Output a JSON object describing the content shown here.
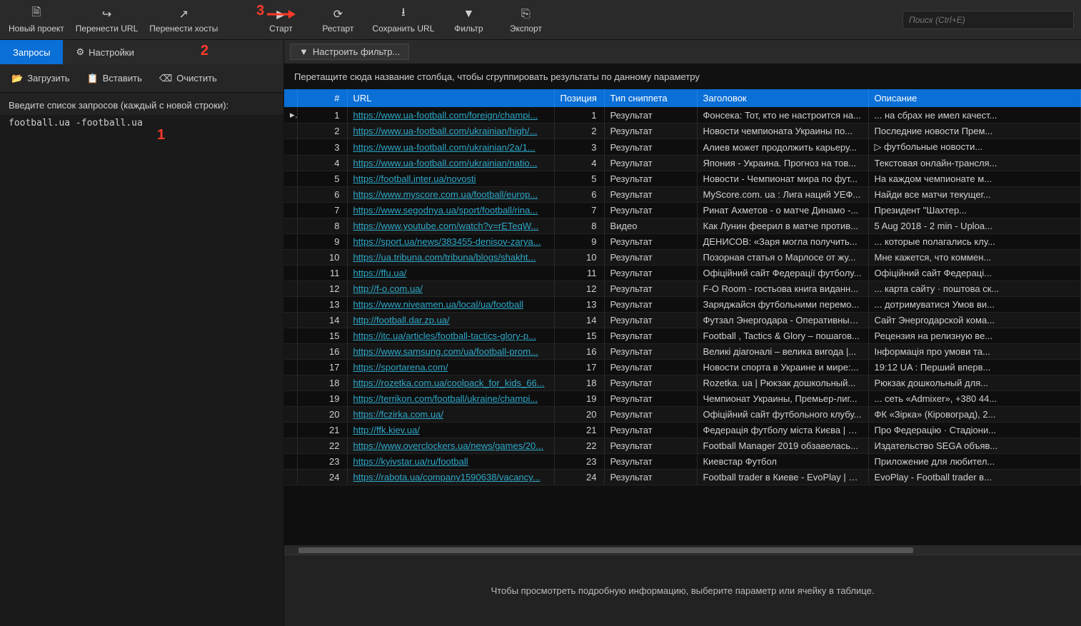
{
  "toolbar": {
    "new_project": "Новый проект",
    "transfer_url": "Перенести URL",
    "transfer_hosts": "Перенести хосты",
    "start": "Старт",
    "restart": "Рестарт",
    "save_url": "Сохранить URL",
    "filter": "Фильтр",
    "export": "Экспорт"
  },
  "search": {
    "placeholder": "Поиск (Ctrl+E)"
  },
  "left": {
    "tab_queries": "Запросы",
    "tab_settings": "Настройки",
    "load": "Загрузить",
    "paste": "Вставить",
    "clear": "Очистить",
    "prompt": "Введите список запросов (каждый с новой строки):",
    "query_text": "football.ua -football.ua"
  },
  "filterbar": {
    "configure": "Настроить фильтр..."
  },
  "group_hint": "Перетащите сюда название столбца, чтобы сгруппировать результаты по данному параметру",
  "columns": {
    "num": "#",
    "url": "URL",
    "position": "Позиция",
    "snippet_type": "Тип сниппета",
    "title": "Заголовок",
    "description": "Описание"
  },
  "rows": [
    {
      "n": 1,
      "url": "https://www.ua-football.com/foreign/champi...",
      "pos": 1,
      "snip": "Результат",
      "title": "Фонсека: Тот, кто не настроится на...",
      "desc": "... на сбрах не имел качест..."
    },
    {
      "n": 2,
      "url": "https://www.ua-football.com/ukrainian/high/...",
      "pos": 2,
      "snip": "Результат",
      "title": "Новости чемпионата Украины по...",
      "desc": "Последние новости Прем..."
    },
    {
      "n": 3,
      "url": "https://www.ua-football.com/ukrainian/2a/1...",
      "pos": 3,
      "snip": "Результат",
      "title": "Алиев может продолжить карьеру...",
      "desc": "▷ футбольные новости..."
    },
    {
      "n": 4,
      "url": "https://www.ua-football.com/ukrainian/natio...",
      "pos": 4,
      "snip": "Результат",
      "title": "Япония - Украина. Прогноз на тов...",
      "desc": "Текстовая онлайн-трансля..."
    },
    {
      "n": 5,
      "url": "https://football.inter.ua/novosti",
      "pos": 5,
      "snip": "Результат",
      "title": "Новости - Чемпионат мира по фут...",
      "desc": "На каждом чемпионате м..."
    },
    {
      "n": 6,
      "url": "https://www.myscore.com.ua/football/europ...",
      "pos": 6,
      "snip": "Результат",
      "title": "MyScore.com. ua : Лига наций УЕФ...",
      "desc": "Найди все матчи текущег..."
    },
    {
      "n": 7,
      "url": "https://www.segodnya.ua/sport/football/rina...",
      "pos": 7,
      "snip": "Результат",
      "title": "Ринат Ахметов - о матче Динамо -...",
      "desc": "Президент &quot;Шахтер..."
    },
    {
      "n": 8,
      "url": "https://www.youtube.com/watch?v=rETeqW...",
      "pos": 8,
      "snip": "Видео",
      "title": "Как Лунин феерил в матче против...",
      "desc": "5 Aug 2018 - 2 min - Uploa..."
    },
    {
      "n": 9,
      "url": "https://sport.ua/news/383455-denisov-zarya...",
      "pos": 9,
      "snip": "Результат",
      "title": "ДЕНИСОВ: «Заря могла получить...",
      "desc": "... которые полагались клу..."
    },
    {
      "n": 10,
      "url": "https://ua.tribuna.com/tribuna/blogs/shakht...",
      "pos": 10,
      "snip": "Результат",
      "title": "Позорная статья о Марлосе от жу...",
      "desc": "Мне кажется, что коммен..."
    },
    {
      "n": 11,
      "url": "https://ffu.ua/",
      "pos": 11,
      "snip": "Результат",
      "title": "Офіційний сайт Федерації футболу...",
      "desc": "Офіційний сайт Федераці..."
    },
    {
      "n": 12,
      "url": "http://f-o.com.ua/",
      "pos": 12,
      "snip": "Результат",
      "title": "F-O Room - гостьова книга виданн...",
      "desc": "... карта сайту · поштова ск..."
    },
    {
      "n": 13,
      "url": "https://www.niveamen.ua/local/ua/football",
      "pos": 13,
      "snip": "Результат",
      "title": "Заряджайся футбольними перемо...",
      "desc": "... дотримуватися Умов ви..."
    },
    {
      "n": 14,
      "url": "http://football.dar.zp.ua/",
      "pos": 14,
      "snip": "Результат",
      "title": "Футзал Энергодара - Оперативные...",
      "desc": "Сайт Энергодарской кома..."
    },
    {
      "n": 15,
      "url": "https://itc.ua/articles/football-tactics-glory-p...",
      "pos": 15,
      "snip": "Результат",
      "title": "Football , Tactics & Glory – пошагов...",
      "desc": "Рецензия на релизную ве..."
    },
    {
      "n": 16,
      "url": "https://www.samsung.com/ua/football-prom...",
      "pos": 16,
      "snip": "Результат",
      "title": "Великі діагоналі – велика вигода |...",
      "desc": "Інформація про умови та..."
    },
    {
      "n": 17,
      "url": "https://sportarena.com/",
      "pos": 17,
      "snip": "Результат",
      "title": "Новости спорта в Украине и мире:...",
      "desc": "19:12 UA : Перший вперв..."
    },
    {
      "n": 18,
      "url": "https://rozetka.com.ua/coolpack_for_kids_66...",
      "pos": 18,
      "snip": "Результат",
      "title": "Rozetka. ua | Рюкзак дошкольный...",
      "desc": "Рюкзак дошкольный для..."
    },
    {
      "n": 19,
      "url": "https://terrikon.com/football/ukraine/champi...",
      "pos": 19,
      "snip": "Результат",
      "title": "Чемпионат Украины, Премьер-лиг...",
      "desc": "... сеть «Admixer», +380 44..."
    },
    {
      "n": 20,
      "url": "https://fczirka.com.ua/",
      "pos": 20,
      "snip": "Результат",
      "title": "Офіційний сайт футбольного клубу...",
      "desc": "ФК «Зірка» (Кіровоград), 2..."
    },
    {
      "n": 21,
      "url": "http://ffk.kiev.ua/",
      "pos": 21,
      "snip": "Результат",
      "title": "Федерація футболу міста Києва | О...",
      "desc": "Про Федерацію · Стадіони..."
    },
    {
      "n": 22,
      "url": "https://www.overclockers.ua/news/games/20...",
      "pos": 22,
      "snip": "Результат",
      "title": "Football Manager 2019 обзавелась...",
      "desc": "Издательство SEGA объяв..."
    },
    {
      "n": 23,
      "url": "https://kyivstar.ua/ru/football",
      "pos": 23,
      "snip": "Результат",
      "title": "Киевстар Футбол",
      "desc": "Приложение для любител..."
    },
    {
      "n": 24,
      "url": "https://rabota.ua/company1590638/vacancy...",
      "pos": 24,
      "snip": "Результат",
      "title": "Football trader в Киеве - EvoPlay | R...",
      "desc": "EvoPlay - Football trader в..."
    }
  ],
  "detail_hint": "Чтобы просмотреть подробную информацию, выберите параметр или ячейку в таблице.",
  "annotations": {
    "a1": "1",
    "a2": "2",
    "a3": "3"
  }
}
